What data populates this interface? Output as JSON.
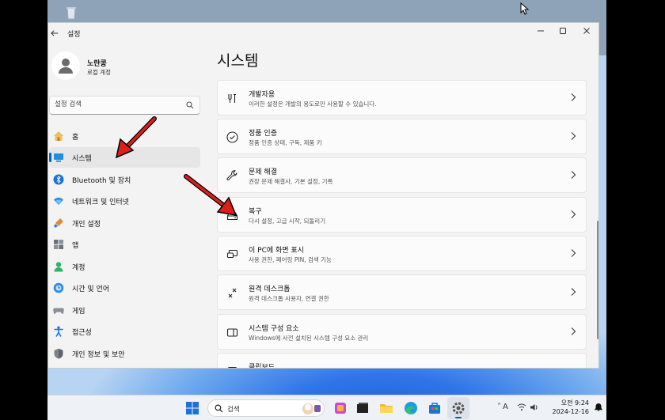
{
  "window": {
    "app_title": "설정",
    "back_icon": "back-arrow-icon",
    "controls": [
      "minimize-icon",
      "maximize-icon",
      "close-icon"
    ]
  },
  "profile": {
    "name": "노란콩",
    "account_type": "로컬 계정"
  },
  "sidebar": {
    "search_placeholder": "설정 검색",
    "items": [
      {
        "label": "홈",
        "icon": "home-icon",
        "selected": false
      },
      {
        "label": "시스템",
        "icon": "system-icon",
        "selected": true
      },
      {
        "label": "Bluetooth 및 장치",
        "icon": "bluetooth-icon",
        "selected": false
      },
      {
        "label": "네트워크 및 인터넷",
        "icon": "network-icon",
        "selected": false
      },
      {
        "label": "개인 설정",
        "icon": "personalization-icon",
        "selected": false
      },
      {
        "label": "앱",
        "icon": "apps-icon",
        "selected": false
      },
      {
        "label": "계정",
        "icon": "accounts-icon",
        "selected": false
      },
      {
        "label": "시간 및 언어",
        "icon": "time-language-icon",
        "selected": false
      },
      {
        "label": "게임",
        "icon": "gaming-icon",
        "selected": false
      },
      {
        "label": "접근성",
        "icon": "accessibility-icon",
        "selected": false
      },
      {
        "label": "개인 정보 및 보안",
        "icon": "privacy-shield-icon",
        "selected": false
      }
    ]
  },
  "main": {
    "title": "시스템",
    "cards": [
      {
        "title": "개발자용",
        "desc": "이러한 설정은 개발의 용도로만 사용할 수 있습니다.",
        "icon": "developer-tools-icon"
      },
      {
        "title": "정품 인증",
        "desc": "정품 인증 상태, 구독, 제품 키",
        "icon": "activation-check-icon"
      },
      {
        "title": "문제 해결",
        "desc": "권장 문제 해결사, 기본 설정, 기록",
        "icon": "wrench-icon"
      },
      {
        "title": "복구",
        "desc": "다시 설정, 고급 시작, 되돌리기",
        "icon": "recovery-drive-icon"
      },
      {
        "title": "이 PC에 화면 표시",
        "desc": "사용 권한, 페어링 PIN, 검색 기능",
        "icon": "project-screen-icon"
      },
      {
        "title": "원격 데스크톱",
        "desc": "원격 데스크톱 사용자, 연결 권한",
        "icon": "remote-desktop-icon"
      },
      {
        "title": "시스템 구성 요소",
        "desc": "Windows에 사전 설치된 시스템 구성 요소 관리",
        "icon": "system-components-icon"
      },
      {
        "title": "클립보드",
        "desc": "",
        "icon": "clipboard-icon"
      }
    ]
  },
  "taskbar": {
    "search_label": "검색",
    "time": "오전 9:24",
    "date": "2024-12-16",
    "ime": "A",
    "accent": "#0067c0"
  }
}
